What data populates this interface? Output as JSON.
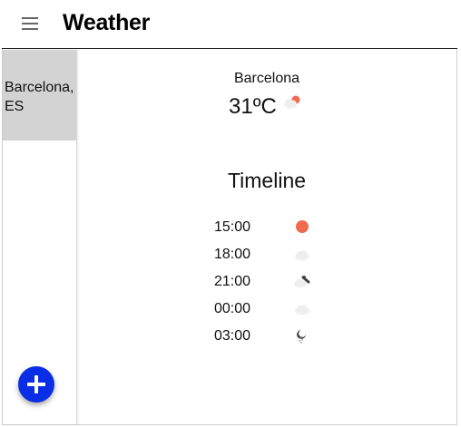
{
  "app": {
    "title": "Weather"
  },
  "sidebar": {
    "items": [
      {
        "label": "Barcelona, ES",
        "selected": true
      }
    ]
  },
  "current": {
    "city": "Barcelona",
    "temperature": "31ºC",
    "icon": "sun-behind-cloud-icon"
  },
  "timeline": {
    "title": "Timeline",
    "entries": [
      {
        "time": "15:00",
        "icon": "sun-icon"
      },
      {
        "time": "18:00",
        "icon": "cloud-icon"
      },
      {
        "time": "21:00",
        "icon": "cloud-night-icon"
      },
      {
        "time": "00:00",
        "icon": "cloud-icon"
      },
      {
        "time": "03:00",
        "icon": "moon-rain-icon"
      }
    ]
  },
  "colors": {
    "fab": "#0a2ee6",
    "selected_item": "#d3d3d3",
    "sun": "#ef6b4f",
    "cloud": "#eeeeee"
  }
}
